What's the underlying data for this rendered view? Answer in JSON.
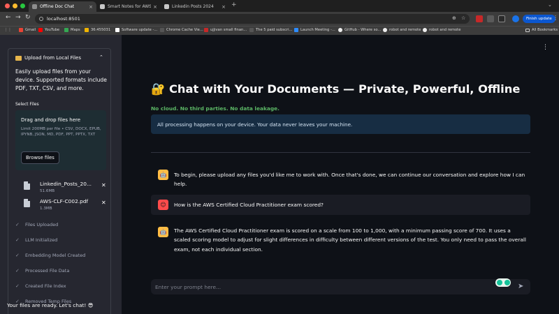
{
  "browser": {
    "tabs": [
      {
        "label": "Offline Doc Chat",
        "active": true,
        "favicon_color": "#8e8e8e"
      },
      {
        "label": "Smart Notes for AWS CLF-C02",
        "active": false,
        "favicon_color": "#c8c8c8"
      },
      {
        "label": "Linkedin Posts 2024",
        "active": false,
        "favicon_color": "#c8c8c8"
      }
    ],
    "new_tab_icon": "plus-icon",
    "url": "localhost:8501",
    "finish_update_label": "Finish update",
    "bookmarks": [
      {
        "label": "Gmail",
        "icon_color": "#ea4335"
      },
      {
        "label": "YouTube",
        "icon_color": "#ff0000"
      },
      {
        "label": "Maps",
        "icon_color": "#34a853"
      },
      {
        "label": "36:455031",
        "icon_color": "#f0b400"
      },
      {
        "label": "Software update -...",
        "icon_color": "#ffffff"
      },
      {
        "label": "Chrome Cache Vie...",
        "icon_color": "#555555"
      },
      {
        "label": "ujjivan small finan...",
        "icon_color": "#c62828"
      },
      {
        "label": "The 5 paid subscri...",
        "icon_color": "#555555"
      },
      {
        "label": "Launch Meeting -...",
        "icon_color": "#2d8cff"
      },
      {
        "label": "GitHub - Where so...",
        "icon_color": "#eeeeee"
      },
      {
        "label": "robot and remote",
        "icon_color": "#eeeeee"
      },
      {
        "label": "robot and remote",
        "icon_color": "#eeeeee"
      }
    ],
    "all_bookmarks_label": "All Bookmarks"
  },
  "sidebar": {
    "expander_title": "Upload from Local Files",
    "description": "Easily upload files from your device. Supported formats include PDF, TXT, CSV, and more.",
    "select_label": "Select Files",
    "dropzone_title": "Drag and drop files here",
    "dropzone_limit": "Limit 200MB per file • CSV, DOCX, EPUB, IPYNB, JSON, MD, PDF, PPT, PPTX, TXT",
    "browse_label": "Browse files",
    "files": [
      {
        "name": "Linkedin_Posts_20...",
        "size": "51.6MB"
      },
      {
        "name": "AWS-CLF-C002.pdf",
        "size": "1.3MB"
      }
    ],
    "status_items": [
      "Files Uploaded",
      "LLM Initialized",
      "Embedding Model Created",
      "Processed File Data",
      "Created File Index",
      "Removed Temp Files"
    ],
    "ready_text": "Your files are ready. Let's chat! 😎"
  },
  "main": {
    "title": "🔐 Chat with Your Documents — Private, Powerful, Offline",
    "subtitle": "No cloud. No third parties. No data leakage.",
    "info": "All processing happens on your device. Your data never leaves your machine.",
    "messages": [
      {
        "role": "assistant",
        "text": "To begin, please upload any files you'd like me to work with. Once that's done, we can continue our conversation and explore how I can help."
      },
      {
        "role": "user",
        "text": "How is the AWS Certified Cloud Practitioner exam scored?"
      },
      {
        "role": "assistant",
        "text": "The AWS Certified Cloud Practitioner exam is scored on a scale from 100 to 1,000, with a minimum passing score of 700. It uses a scaled scoring model to adjust for slight differences in difficulty between different versions of the test. You only need to pass the overall exam, not each individual section."
      }
    ],
    "input_placeholder": "Enter your prompt here...",
    "send_icon": "send-icon"
  }
}
